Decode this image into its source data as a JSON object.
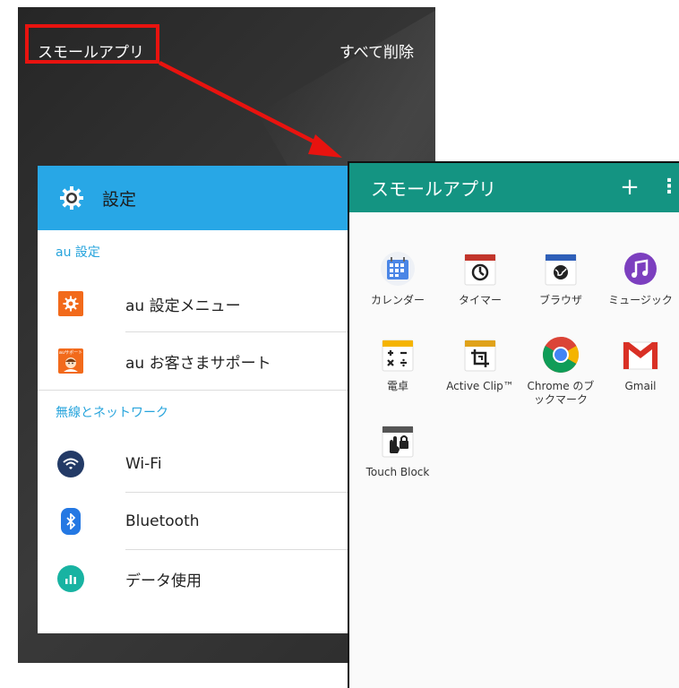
{
  "recents": {
    "small_app_label": "スモールアプリ",
    "delete_all_label": "すべて削除"
  },
  "settings": {
    "title": "設定",
    "sections": [
      {
        "label": "au 設定",
        "items": [
          {
            "label": "au 設定メニュー",
            "icon": "au-settings-menu-icon"
          },
          {
            "label": "au お客さまサポート",
            "icon": "au-support-icon"
          }
        ]
      },
      {
        "label": "無線とネットワーク",
        "items": [
          {
            "label": "Wi-Fi",
            "icon": "wifi-icon"
          },
          {
            "label": "Bluetooth",
            "icon": "bluetooth-icon"
          },
          {
            "label": "データ使用",
            "icon": "data-usage-icon"
          }
        ]
      }
    ],
    "support_icon_text": "auサポート"
  },
  "small_app_panel": {
    "title": "スモールアプリ",
    "add_label": "+",
    "more_label": "⋮",
    "apps": [
      {
        "label": "カレンダー",
        "icon": "calendar-icon"
      },
      {
        "label": "タイマー",
        "icon": "timer-icon"
      },
      {
        "label": "ブラウザ",
        "icon": "browser-icon"
      },
      {
        "label": "ミュージック",
        "icon": "music-icon"
      },
      {
        "label": "電卓",
        "icon": "calculator-icon"
      },
      {
        "label": "Active Clip™",
        "icon": "active-clip-icon"
      },
      {
        "label": "Chrome のブ\nックマーク",
        "icon": "chrome-icon"
      },
      {
        "label": "Gmail",
        "icon": "gmail-icon"
      },
      {
        "label": "Touch Block",
        "icon": "touch-block-icon"
      }
    ]
  },
  "colors": {
    "highlight": "#e8130f",
    "settings_header": "#28a7e6",
    "section_label": "#27a4dc",
    "panel_header": "#149482"
  }
}
